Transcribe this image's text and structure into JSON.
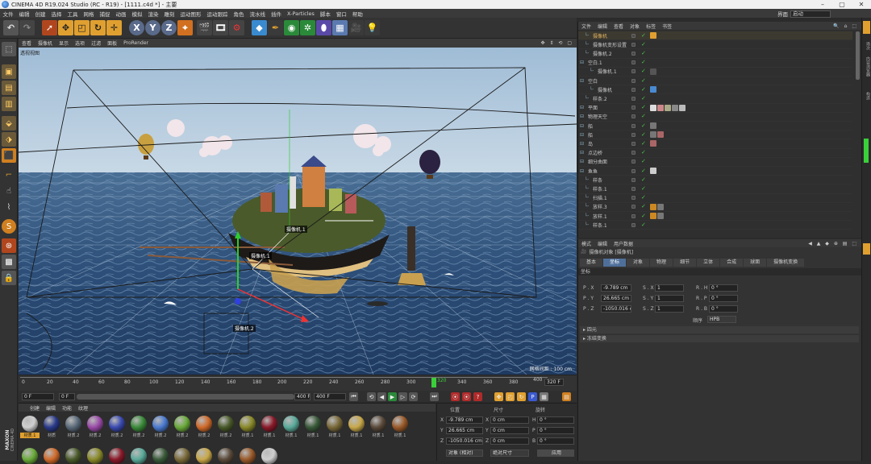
{
  "window": {
    "title": "CINEMA 4D R19.024 Studio (RC - R19) - [1111.c4d *] - 主要"
  },
  "menubar": {
    "items": [
      "文件",
      "编辑",
      "创建",
      "选择",
      "工具",
      "网格",
      "捕捉",
      "动画",
      "模拟",
      "渲染",
      "雕刻",
      "运动图形",
      "运动跟踪",
      "角色",
      "流水线",
      "插件",
      "X-Particles",
      "脚本",
      "窗口",
      "帮助"
    ],
    "interface_label": "界面",
    "interface_value": "启动"
  },
  "viewport": {
    "menu": [
      "查看",
      "摄像机",
      "显示",
      "选项",
      "过滤",
      "面板",
      "ProRender"
    ],
    "camera_label": "透视视图",
    "grid_label": "网格间距 : 100 cm",
    "camera_tags": [
      "摄像机.1",
      "摄像机.1",
      "摄像机.2"
    ]
  },
  "timeline": {
    "ticks": [
      "0",
      "20",
      "40",
      "60",
      "80",
      "100",
      "120",
      "140",
      "160",
      "180",
      "200",
      "220",
      "240",
      "260",
      "280",
      "300",
      "320",
      "340",
      "360",
      "380",
      "400"
    ],
    "current_frame_marker": "320",
    "end_label": "320 F"
  },
  "transport": {
    "start_field": "0 F",
    "current_field": "0 F",
    "range_field": "400 F",
    "end_field": "400 F"
  },
  "materials": {
    "menu": [
      "创建",
      "编辑",
      "功能",
      "纹理"
    ],
    "items": [
      {
        "name": "材质.1",
        "color": "#cfcfcf"
      },
      {
        "name": "材质",
        "color": "#2a3a8a"
      },
      {
        "name": "材质.2",
        "color": "#5a6a7a"
      },
      {
        "name": "材质.2",
        "color": "#9a4aa8"
      },
      {
        "name": "材质.2",
        "color": "#3a4ab0"
      },
      {
        "name": "材质.2",
        "color": "#3a8a3a"
      },
      {
        "name": "材质.2",
        "color": "#4a7ad0"
      },
      {
        "name": "材质.2",
        "color": "#6aaa3a"
      },
      {
        "name": "材质.2",
        "color": "#d06a2a"
      },
      {
        "name": "材质.2",
        "color": "#4a5a2a"
      },
      {
        "name": "材质.1",
        "color": "#8a8a2a"
      },
      {
        "name": "材质.1",
        "color": "#8a1a2a"
      },
      {
        "name": "材质.1",
        "color": "#5aaa9a"
      },
      {
        "name": "材质.1",
        "color": "#3a5a3a"
      },
      {
        "name": "材质.1",
        "color": "#7a6a3a"
      },
      {
        "name": "材质.1",
        "color": "#c8a84a"
      },
      {
        "name": "材质.1",
        "color": "#5a4a3a"
      },
      {
        "name": "材质.1",
        "color": "#9a5a2a"
      }
    ],
    "side_logo_line1": "MAXON",
    "side_logo_line2": "CINEMA 4D"
  },
  "coords": {
    "headers": [
      "位置",
      "尺寸",
      "旋转"
    ],
    "rows": [
      {
        "axis": "X",
        "pos": "-9.789 cm",
        "size_axis": "X",
        "size": "0 cm",
        "rot_axis": "H",
        "rot": "0 °"
      },
      {
        "axis": "Y",
        "pos": "26.665 cm",
        "size_axis": "Y",
        "size": "0 cm",
        "rot_axis": "P",
        "rot": "0 °"
      },
      {
        "axis": "Z",
        "pos": "-1050.016 cm",
        "size_axis": "Z",
        "size": "0 cm",
        "rot_axis": "B",
        "rot": "0 °"
      }
    ],
    "mode_select": "对象 (相对)",
    "size_select": "绝对尺寸",
    "apply_button": "应用"
  },
  "objects": {
    "menu": [
      "文件",
      "编辑",
      "查看",
      "对象",
      "标签",
      "书签"
    ],
    "rows": [
      {
        "name": "摄像机",
        "indent": 1,
        "color": "#e0b060"
      },
      {
        "name": "摄像机变形设置",
        "indent": 1,
        "color": "#c8c8c8"
      },
      {
        "name": "摄像机.2",
        "indent": 1,
        "color": "#c8c8c8"
      },
      {
        "name": "空白.1",
        "indent": 0,
        "color": "#c8c8c8"
      },
      {
        "name": "摄像机.1",
        "indent": 2,
        "color": "#c8c8c8"
      },
      {
        "name": "空白",
        "indent": 0,
        "color": "#c8c8c8"
      },
      {
        "name": "摄像机",
        "indent": 2,
        "color": "#c8c8c8"
      },
      {
        "name": "样条.2",
        "indent": 1,
        "color": "#c8c8c8"
      },
      {
        "name": "平面",
        "indent": 0,
        "color": "#c8c8c8"
      },
      {
        "name": "物理天空",
        "indent": 0,
        "color": "#c8c8c8"
      },
      {
        "name": "船",
        "indent": 0,
        "color": "#c8c8c8"
      },
      {
        "name": "船",
        "indent": 0,
        "color": "#c8c8c8"
      },
      {
        "name": "岛",
        "indent": 0,
        "color": "#c8c8c8"
      },
      {
        "name": "点边桥",
        "indent": 0,
        "color": "#c8c8c8"
      },
      {
        "name": "细分曲面",
        "indent": 0,
        "color": "#c8c8c8"
      },
      {
        "name": "鱼鱼",
        "indent": 0,
        "color": "#c8c8c8"
      },
      {
        "name": "样条",
        "indent": 1,
        "color": "#c8c8c8"
      },
      {
        "name": "样条.1",
        "indent": 1,
        "color": "#c8c8c8"
      },
      {
        "name": "扫描.1",
        "indent": 1,
        "color": "#c8c8c8"
      },
      {
        "name": "放样.3",
        "indent": 1,
        "color": "#c8c8c8"
      },
      {
        "name": "放样.1",
        "indent": 1,
        "color": "#c8c8c8"
      },
      {
        "name": "样条.1",
        "indent": 1,
        "color": "#c8c8c8"
      }
    ]
  },
  "attributes": {
    "menu": [
      "模式",
      "编辑",
      "用户数据"
    ],
    "object_title": "摄像机对象 [摄像机]",
    "tabs": [
      "基本",
      "坐标",
      "对象",
      "物理",
      "细节",
      "立体",
      "合成",
      "球面",
      "摄像机变换"
    ],
    "active_tab": "坐标",
    "section": "坐标",
    "rows": [
      {
        "p": "P . X",
        "pv": "-9.789 cm",
        "s": "S . X",
        "sv": "1",
        "r": "R . H",
        "rv": "0 °"
      },
      {
        "p": "P . Y",
        "pv": "26.665 cm",
        "s": "S . Y",
        "sv": "1",
        "r": "R . P",
        "rv": "0 °"
      },
      {
        "p": "P . Z",
        "pv": "-1050.016 cm",
        "s": "S . Z",
        "sv": "1",
        "r": "R . B",
        "rv": "0 °"
      }
    ],
    "order_label": "顺序",
    "order_value": "HPB",
    "collapsed": [
      "四元",
      "冻结变换"
    ]
  },
  "rightstrip": {
    "labels": [
      "对象",
      "场次",
      "内容浏览器",
      "构造"
    ]
  },
  "colors": {
    "accent": "#4f6f9a",
    "highlight_orange": "#e0a030"
  }
}
